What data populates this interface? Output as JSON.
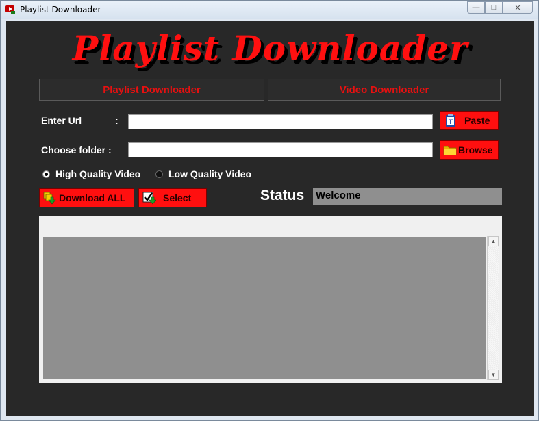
{
  "window": {
    "title": "Playlist Downloader"
  },
  "app": {
    "logo": "Playlist Downloader",
    "tabs": [
      {
        "label": "Playlist Downloader"
      },
      {
        "label": "Video Downloader"
      }
    ],
    "url": {
      "label": "Enter Url",
      "colon": ":",
      "value": "",
      "paste_label": "Paste"
    },
    "folder": {
      "label": "Choose folder :",
      "value": "",
      "browse_label": "Browse"
    },
    "quality": {
      "high_label": "High Quality Video",
      "low_label": "Low Quality Video",
      "selected": "high"
    },
    "actions": {
      "download_all_label": "Download ALL",
      "select_label": "Select"
    },
    "status": {
      "label": "Status",
      "value": "Welcome"
    }
  },
  "colors": {
    "accent": "#ff0f0f",
    "background": "#282828",
    "status_bg": "#8f8f8f"
  }
}
